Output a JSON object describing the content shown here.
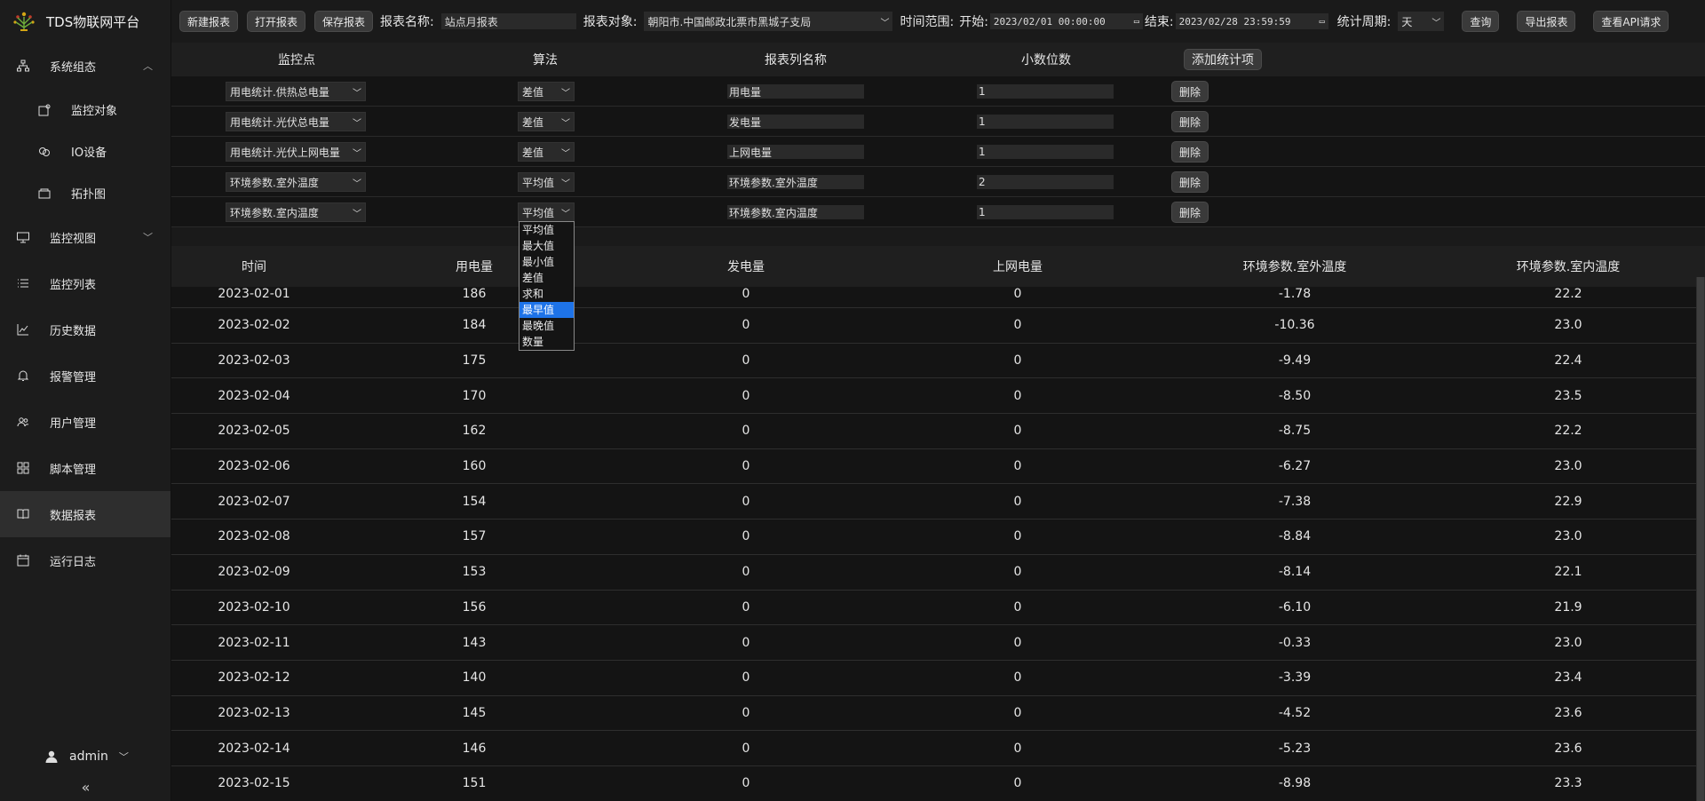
{
  "app": {
    "title": "TDS物联网平台"
  },
  "sidebar": {
    "items": [
      {
        "label": "系统组态",
        "icon": "sitemap-icon",
        "expanded": true
      },
      {
        "label": "监控对象",
        "icon": "monitor-object-icon",
        "sub": true
      },
      {
        "label": "IO设备",
        "icon": "io-device-icon",
        "sub": true
      },
      {
        "label": "拓扑图",
        "icon": "topology-icon",
        "sub": true
      },
      {
        "label": "监控视图",
        "icon": "desktop-icon"
      },
      {
        "label": "监控列表",
        "icon": "list-icon"
      },
      {
        "label": "历史数据",
        "icon": "line-chart-icon"
      },
      {
        "label": "报警管理",
        "icon": "bell-icon"
      },
      {
        "label": "用户管理",
        "icon": "users-icon"
      },
      {
        "label": "脚本管理",
        "icon": "grid-icon"
      },
      {
        "label": "数据报表",
        "icon": "book-icon",
        "active": true
      },
      {
        "label": "运行日志",
        "icon": "calendar-icon"
      }
    ],
    "user": "admin"
  },
  "toolbar": {
    "new_report": "新建报表",
    "open_report": "打开报表",
    "save_report": "保存报表",
    "report_name_label": "报表名称:",
    "report_name_value": "站点月报表",
    "report_target_label": "报表对象:",
    "report_target_value": "朝阳市.中国邮政北票市黑城子支局",
    "time_range_label": "时间范围:",
    "start_label": "开始:",
    "start_value": "2023/02/01 00:00:00",
    "end_label": "结束:",
    "end_value": "2023/02/28 23:59:59",
    "period_label": "统计周期:",
    "period_value": "天",
    "query": "查询",
    "export": "导出报表",
    "api": "查看API请求"
  },
  "config": {
    "headers": {
      "point": "监控点",
      "algo": "算法",
      "col_name": "报表列名称",
      "decimals": "小数位数"
    },
    "add_button": "添加统计项",
    "delete_label": "删除",
    "rows": [
      {
        "point": "用电统计.供热总电量",
        "algo": "差值",
        "col_name": "用电量",
        "decimals": "1"
      },
      {
        "point": "用电统计.光伏总电量",
        "algo": "差值",
        "col_name": "发电量",
        "decimals": "1"
      },
      {
        "point": "用电统计.光伏上网电量",
        "algo": "差值",
        "col_name": "上网电量",
        "decimals": "1"
      },
      {
        "point": "环境参数.室外温度",
        "algo": "平均值",
        "col_name": "环境参数.室外温度",
        "decimals": "2"
      },
      {
        "point": "环境参数.室内温度",
        "algo": "平均值",
        "col_name": "环境参数.室内温度",
        "decimals": "1"
      }
    ]
  },
  "dropdown": {
    "options": [
      "平均值",
      "最大值",
      "最小值",
      "差值",
      "求和",
      "最早值",
      "最晚值",
      "数量"
    ],
    "highlighted": "最早值"
  },
  "table": {
    "headers": [
      "时间",
      "用电量",
      "发电量",
      "上网电量",
      "环境参数.室外温度",
      "环境参数.室内温度"
    ],
    "rows": [
      [
        "2023-02-01",
        "186",
        "0",
        "0",
        "-1.78",
        "22.2"
      ],
      [
        "2023-02-02",
        "184",
        "0",
        "0",
        "-10.36",
        "23.0"
      ],
      [
        "2023-02-03",
        "175",
        "0",
        "0",
        "-9.49",
        "22.4"
      ],
      [
        "2023-02-04",
        "170",
        "0",
        "0",
        "-8.50",
        "23.5"
      ],
      [
        "2023-02-05",
        "162",
        "0",
        "0",
        "-8.75",
        "22.2"
      ],
      [
        "2023-02-06",
        "160",
        "0",
        "0",
        "-6.27",
        "23.0"
      ],
      [
        "2023-02-07",
        "154",
        "0",
        "0",
        "-7.38",
        "22.9"
      ],
      [
        "2023-02-08",
        "157",
        "0",
        "0",
        "-8.84",
        "23.0"
      ],
      [
        "2023-02-09",
        "153",
        "0",
        "0",
        "-8.14",
        "22.1"
      ],
      [
        "2023-02-10",
        "156",
        "0",
        "0",
        "-6.10",
        "21.9"
      ],
      [
        "2023-02-11",
        "143",
        "0",
        "0",
        "-0.33",
        "23.0"
      ],
      [
        "2023-02-12",
        "140",
        "0",
        "0",
        "-3.39",
        "23.4"
      ],
      [
        "2023-02-13",
        "145",
        "0",
        "0",
        "-4.52",
        "23.6"
      ],
      [
        "2023-02-14",
        "146",
        "0",
        "0",
        "-5.23",
        "23.6"
      ],
      [
        "2023-02-15",
        "151",
        "0",
        "0",
        "-8.98",
        "23.3"
      ]
    ]
  }
}
